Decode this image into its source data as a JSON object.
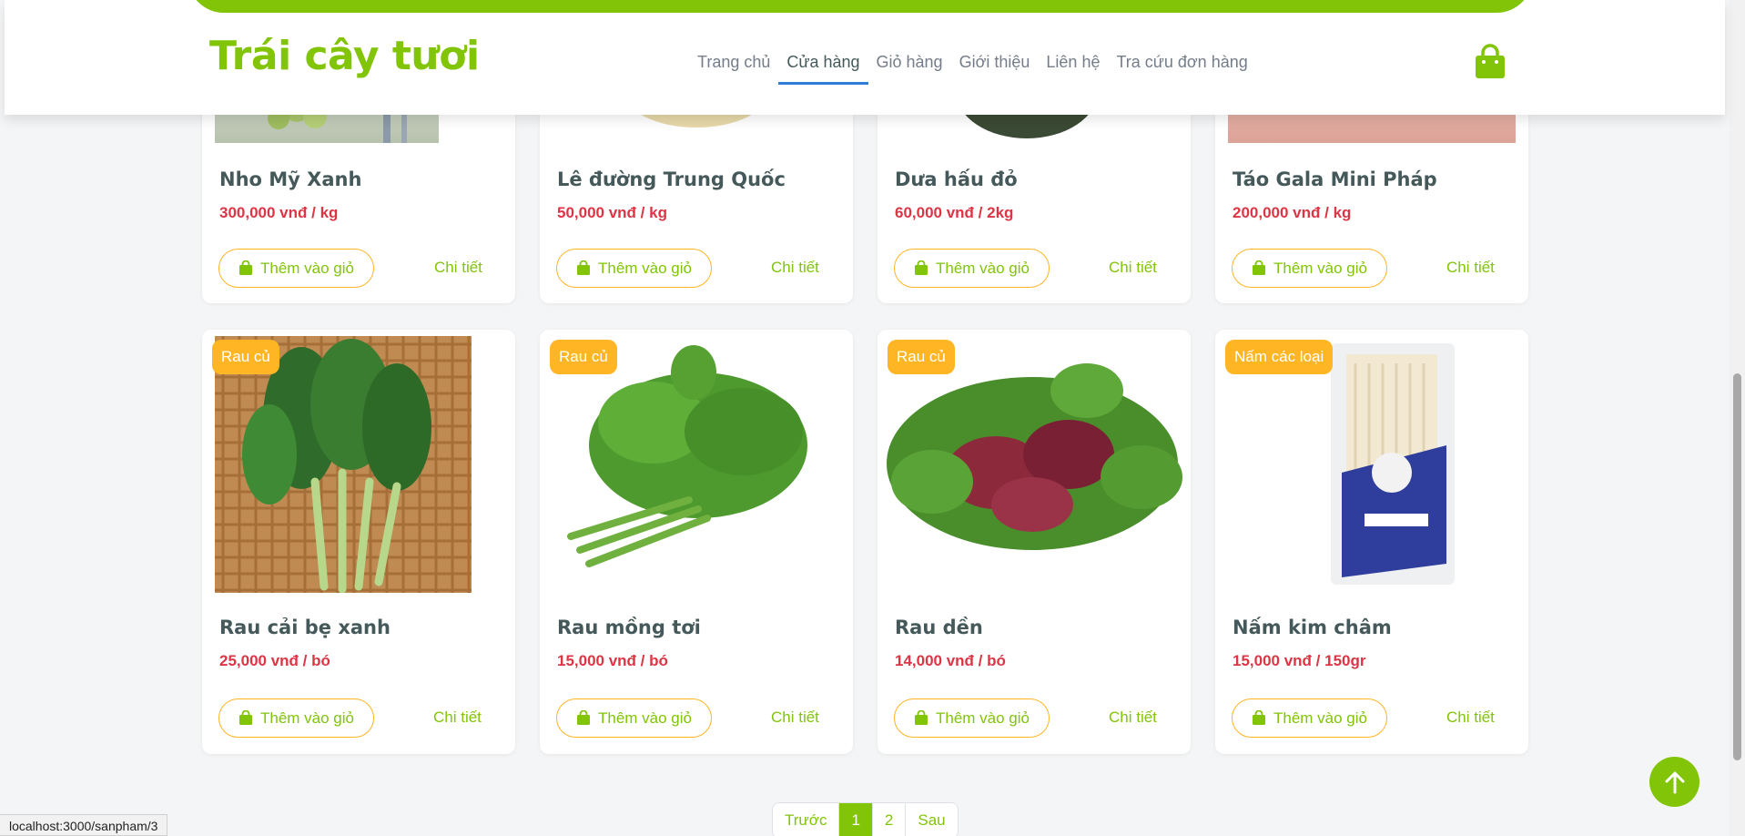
{
  "header": {
    "brand": "Trái cây tươi",
    "nav": [
      "Trang chủ",
      "Cửa hàng",
      "Giỏ hàng",
      "Giới thiệu",
      "Liên hệ",
      "Tra cứu đơn hàng"
    ],
    "active_nav": "Cửa hàng",
    "cart_icon": "shopping-bag-icon"
  },
  "products_top": [
    {
      "name": "Nho Mỹ Xanh",
      "price": "300,000 vnđ / kg",
      "add": "Thêm vào giỏ",
      "detail": "Chi tiết"
    },
    {
      "name": "Lê đường Trung Quốc",
      "price": "50,000 vnđ / kg",
      "add": "Thêm vào giỏ",
      "detail": "Chi tiết"
    },
    {
      "name": "Dưa hấu đỏ",
      "price": "60,000 vnđ / 2kg",
      "add": "Thêm vào giỏ",
      "detail": "Chi tiết"
    },
    {
      "name": "Táo Gala Mini Pháp",
      "price": "200,000 vnđ / kg",
      "add": "Thêm vào giỏ",
      "detail": "Chi tiết"
    }
  ],
  "products_bottom": [
    {
      "badge": "Rau củ",
      "name": "Rau cải bẹ xanh",
      "price": "25,000 vnđ / bó",
      "add": "Thêm vào giỏ",
      "detail": "Chi tiết"
    },
    {
      "badge": "Rau củ",
      "name": "Rau mồng tơi",
      "price": "15,000 vnđ / bó",
      "add": "Thêm vào giỏ",
      "detail": "Chi tiết"
    },
    {
      "badge": "Rau củ",
      "name": "Rau dền",
      "price": "14,000 vnđ / bó",
      "add": "Thêm vào giỏ",
      "detail": "Chi tiết"
    },
    {
      "badge": "Nấm các loại",
      "name": "Nấm kim châm",
      "price": "15,000 vnđ / 150gr",
      "add": "Thêm vào giỏ",
      "detail": "Chi tiết"
    }
  ],
  "pagination": {
    "prev": "Trước",
    "pages": [
      "1",
      "2"
    ],
    "current": "1",
    "next": "Sau"
  },
  "status_url": "localhost:3000/sanpham/3",
  "colors": {
    "accent": "#81c408",
    "badge": "#ffb524",
    "price": "#dc3545",
    "heading": "#45595b"
  }
}
